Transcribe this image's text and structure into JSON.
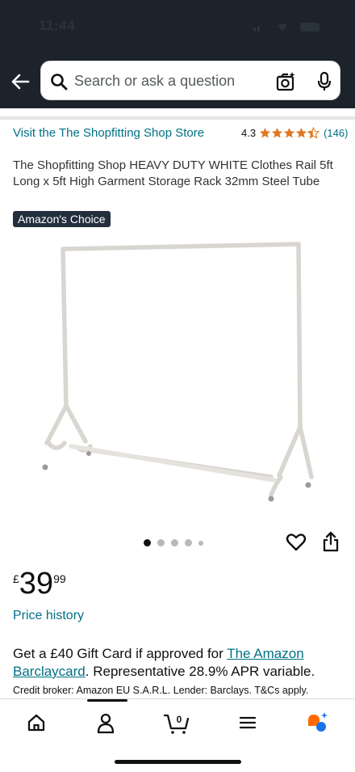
{
  "status_bar": {
    "time": "11:44"
  },
  "search": {
    "placeholder": "Search or ask a question"
  },
  "product": {
    "store_link": "Visit the The Shopfitting Shop Store",
    "rating": "4.3",
    "rating_stars": 4.3,
    "review_count": "(146)",
    "title": "The Shopfitting Shop HEAVY DUTY WHITE Clothes Rail 5ft Long x 5ft High Garment Storage Rack 32mm Steel Tube",
    "badge": "Amazon's Choice",
    "image_count": 5,
    "active_image": 1
  },
  "price": {
    "symbol": "£",
    "whole": "39",
    "fraction": "99",
    "history_label": "Price history"
  },
  "offer": {
    "text_before": "Get a £40 Gift Card if approved for ",
    "link": "The Amazon Barclaycard",
    "text_after": ". Representative 28.9% APR variable.",
    "credit_line": "Credit broker: Amazon EU S.A.R.L. Lender: Barclays. T&Cs apply."
  },
  "bottom_nav": {
    "items": [
      "home-icon",
      "account-icon",
      "cart-icon",
      "menu-icon",
      "ai-assistant-icon"
    ],
    "cart_count": "0"
  },
  "colors": {
    "header": "#1c232b",
    "link": "#007185",
    "star": "#de7921",
    "badge": "#232f3e"
  }
}
